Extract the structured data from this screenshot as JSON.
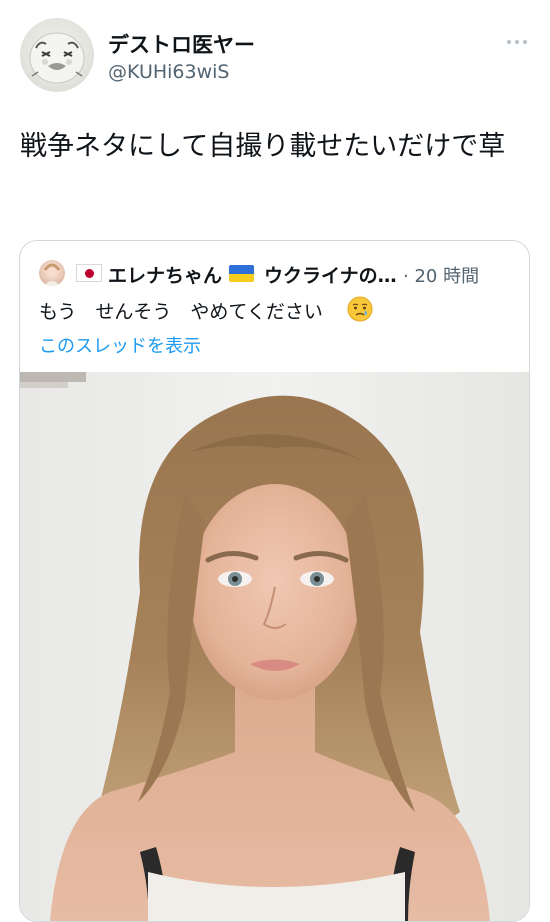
{
  "tweet": {
    "author_name": "デストロ医ヤー",
    "author_handle": "@KUHi63wiS",
    "text": "戦争ネタにして自撮り載せたいだけで草",
    "more_icon": "more-horizontal-icon",
    "avatar_icon": "cartoon-avatar"
  },
  "quoted": {
    "author_name_part1": "エレナちゃん",
    "author_name_part2": "ウクライナの…",
    "time": "· 20 時間",
    "text": "もう　せんそう　やめてください",
    "emoji": "crying-face-emoji",
    "show_thread": "このスレッドを表示",
    "flags": [
      "japan-flag",
      "ukraine-flag"
    ],
    "image": "selfie-photo"
  },
  "colors": {
    "text_primary": "#0f1419",
    "text_secondary": "#536471",
    "link": "#1d9bf0",
    "border": "#cfd9de"
  }
}
